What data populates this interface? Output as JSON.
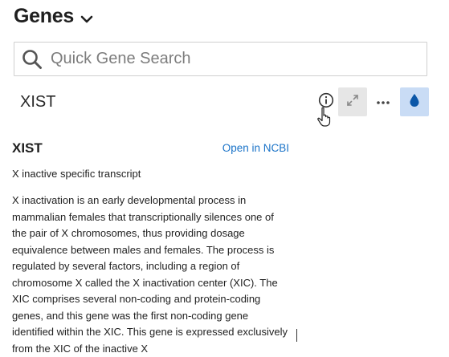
{
  "header": {
    "title": "Genes"
  },
  "search": {
    "placeholder": "Quick Gene Search",
    "value": ""
  },
  "selected_gene": {
    "symbol": "XIST"
  },
  "toolbar": {
    "buttons": [
      {
        "icon": "info-circle-icon"
      },
      {
        "icon": "expand-icon"
      },
      {
        "icon": "more-horizontal-icon"
      },
      {
        "icon": "droplet-icon"
      }
    ]
  },
  "detail": {
    "symbol": "XIST",
    "link_label": "Open in NCBI",
    "full_name": "X inactive specific transcript",
    "description": "X inactivation is an early developmental process in mammalian females that transcriptionally silences one of the pair of X chromosomes, thus providing dosage equivalence between males and females. The process is regulated by several factors, including a region of chromosome X called the X inactivation center (XIC). The XIC comprises several non-coding and protein-coding genes, and this gene was the first non-coding gene identified within the XIC. This gene is expressed exclusively from the XIC of the inactive X"
  },
  "colors": {
    "accent": "#1a73c8",
    "theme_button_bg": "#c9dcf5",
    "icon_blue": "#0b57a8"
  }
}
